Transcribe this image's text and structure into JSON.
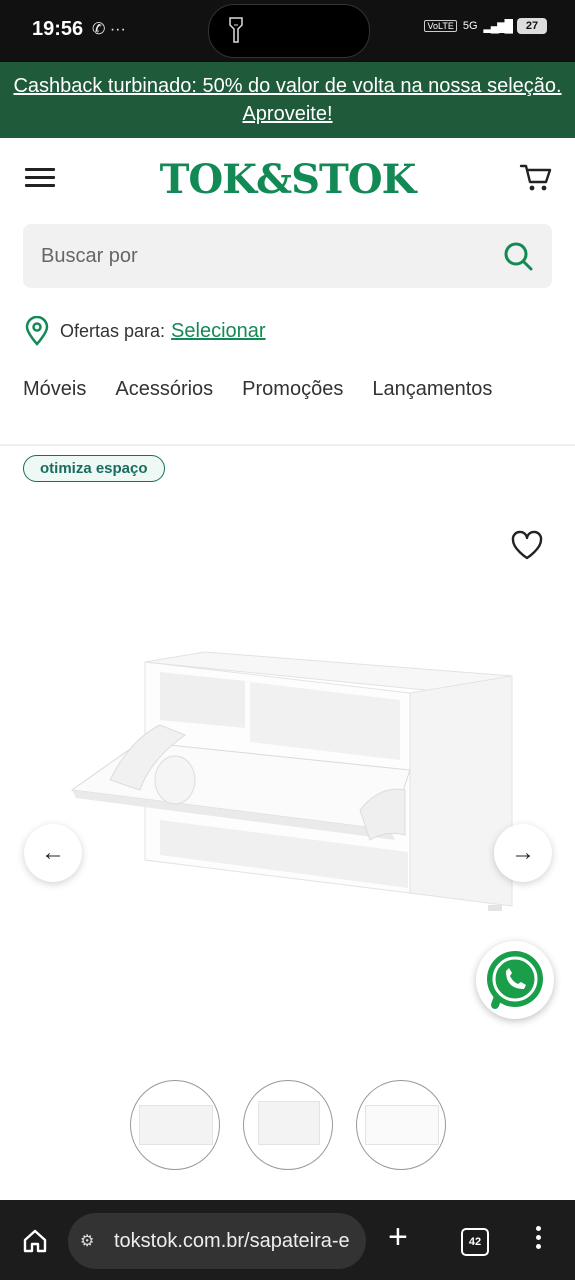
{
  "status_bar": {
    "time": "19:56",
    "battery": "27",
    "network": "5G",
    "volte": "VoLTE"
  },
  "promo_banner": {
    "text": "Cashback turbinado: 50% do valor de volta na nossa seleção. Aproveite!"
  },
  "header": {
    "logo": "TOK&STOK"
  },
  "search": {
    "placeholder": "Buscar por"
  },
  "location": {
    "label": "Ofertas para:",
    "link": "Selecionar"
  },
  "nav": {
    "items": [
      "Móveis",
      "Acessórios",
      "Promoções",
      "Lançamentos"
    ]
  },
  "product": {
    "badge": "otimiza espaço"
  },
  "browser": {
    "url": "tokstok.com.br/sapateira-e",
    "tab_count": "42"
  },
  "colors": {
    "brand_green": "#138a55",
    "banner_green": "#1f5a3a",
    "badge_teal": "#1a6d5e"
  }
}
